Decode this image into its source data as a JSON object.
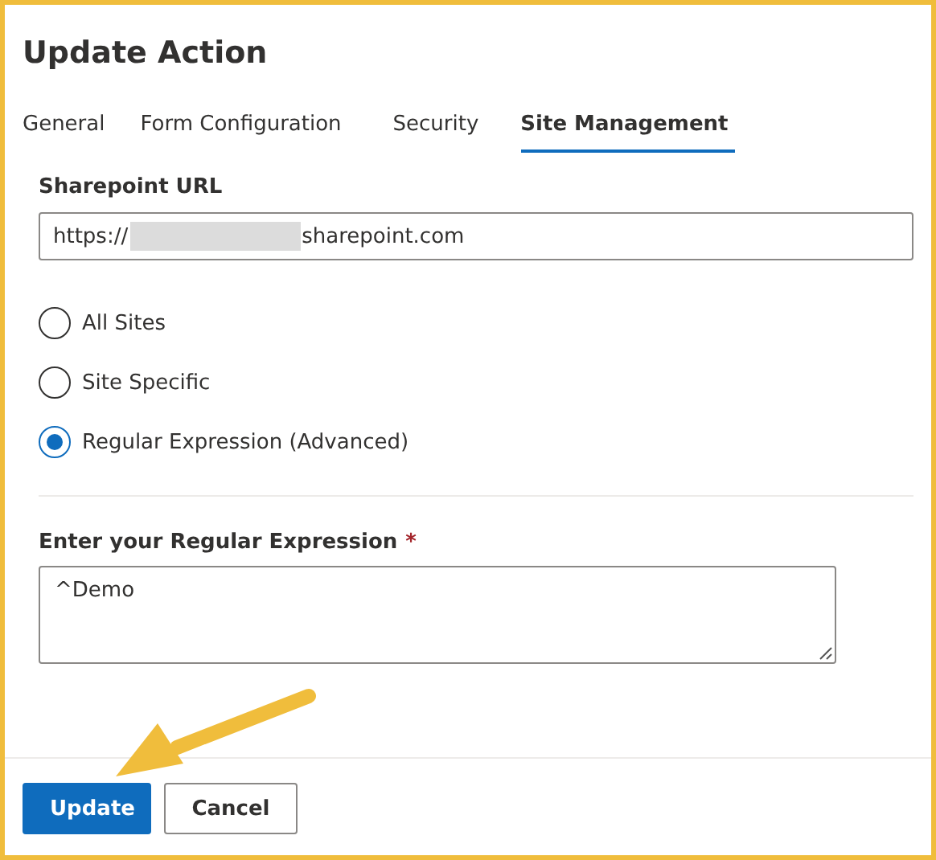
{
  "dialog": {
    "title": "Update Action"
  },
  "tabs": [
    {
      "label": "General",
      "selected": false
    },
    {
      "label": "Form Configuration",
      "selected": false
    },
    {
      "label": "Security",
      "selected": false
    },
    {
      "label": "Site Management",
      "selected": true
    }
  ],
  "url_field": {
    "label": "Sharepoint URL",
    "value_prefix": "https://",
    "value_suffix": "sharepoint.com"
  },
  "scope_options": [
    {
      "label": "All Sites",
      "selected": false
    },
    {
      "label": "Site Specific",
      "selected": false
    },
    {
      "label": "Regular Expression (Advanced)",
      "selected": true
    }
  ],
  "regex_field": {
    "label": "Enter your Regular Expression",
    "required_mark": "*",
    "value": "^Demo"
  },
  "buttons": [
    {
      "label": "Update",
      "kind": "primary"
    },
    {
      "label": "Cancel",
      "kind": "secondary"
    }
  ]
}
